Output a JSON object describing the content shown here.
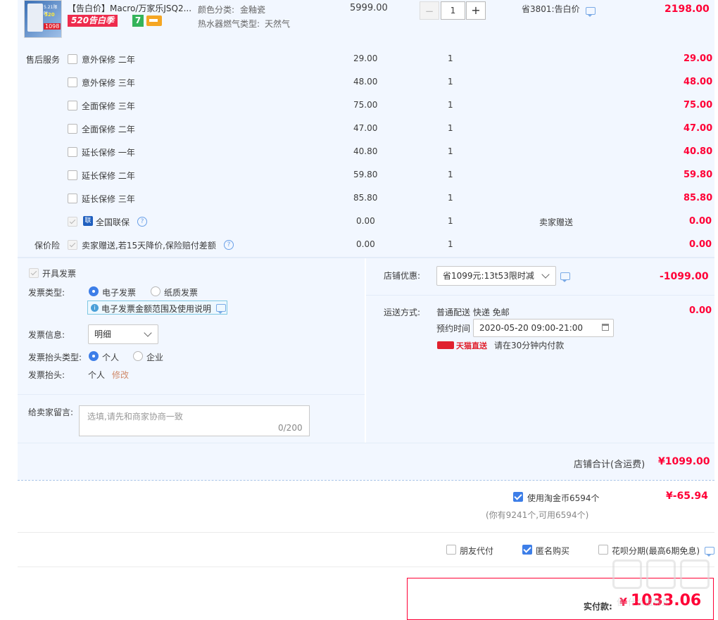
{
  "product": {
    "title": "【告白价】Macro/万家乐JSQ2...",
    "badge": "520告白季",
    "badge_num": "7",
    "color_label": "颜色分类:",
    "color_value": "金釉瓷",
    "gas_label": "热水器燃气类型:",
    "gas_value": "天然气",
    "price": "5999.00",
    "qty": "1",
    "minus": "−",
    "plus": "+",
    "promo": "省3801:告白价",
    "subtotal": "2198.00",
    "thumb_text": [
      "5.21限时",
      "520",
      "1098"
    ]
  },
  "services": {
    "label": "售后服务",
    "items": [
      {
        "name": "意外保修 二年",
        "price": "29.00",
        "qty": "1",
        "total": "29.00"
      },
      {
        "name": "意外保修 三年",
        "price": "48.00",
        "qty": "1",
        "total": "48.00"
      },
      {
        "name": "全面保修 三年",
        "price": "75.00",
        "qty": "1",
        "total": "75.00"
      },
      {
        "name": "全面保修 二年",
        "price": "47.00",
        "qty": "1",
        "total": "47.00"
      },
      {
        "name": "延长保修 一年",
        "price": "40.80",
        "qty": "1",
        "total": "40.80"
      },
      {
        "name": "延长保修 二年",
        "price": "59.80",
        "qty": "1",
        "total": "59.80"
      },
      {
        "name": "延长保修 三年",
        "price": "85.80",
        "qty": "1",
        "total": "85.80"
      }
    ],
    "national": {
      "name": "全国联保",
      "icon_text": "联",
      "price": "0.00",
      "qty": "1",
      "note": "卖家赠送",
      "total": "0.00"
    }
  },
  "insurance": {
    "label": "保价险",
    "text": "卖家赠送,若15天降价,保险赔付差额",
    "price": "0.00",
    "qty": "1",
    "total": "0.00"
  },
  "invoice": {
    "toggle": "开具发票",
    "type_label": "发票类型:",
    "type_electronic": "电子发票",
    "type_paper": "纸质发票",
    "notice": "电子发票金额范围及使用说明",
    "info_label": "发票信息:",
    "info_value": "明细",
    "header_type_label": "发票抬头类型:",
    "header_personal": "个人",
    "header_company": "企业",
    "header_label": "发票抬头:",
    "header_value": "个人",
    "header_edit": "修改"
  },
  "message": {
    "label": "给卖家留言:",
    "placeholder": "选填,请先和商家协商一致",
    "counter": "0/200"
  },
  "store_discount": {
    "label": "店铺优惠:",
    "value": "省1099元:13t53限时减",
    "amount": "-1099.00"
  },
  "shipping": {
    "label": "运送方式:",
    "method": "普通配送 快递 免邮",
    "time_label": "预约时间",
    "time_value": "2020-05-20 09:00-21:00",
    "brand": "天猫直送",
    "note": "请在30分钟内付款",
    "amount": "0.00"
  },
  "store_total": {
    "label": "店铺合计(含运费)",
    "amount": "¥1099.00"
  },
  "coins": {
    "label": "使用淘金币6594个",
    "amount": "¥-65.94",
    "sub": "(你有9241个,可用6594个)"
  },
  "options": {
    "friend": "朋友代付",
    "anon": "匿名购买",
    "huabei": "花呗分期(最高6期免息)"
  },
  "payment": {
    "label": "实付款:",
    "currency": "¥",
    "amount": "1033.06"
  },
  "watermark": "值 什么值得买",
  "colors": {
    "accent": "#3d7ee8",
    "price_red": "#ff0036",
    "panel_bg": "#f2f7ff"
  }
}
